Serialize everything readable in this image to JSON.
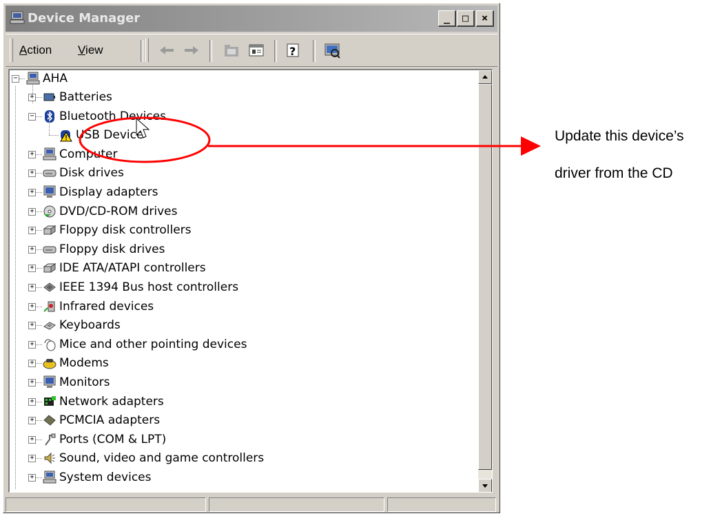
{
  "window": {
    "title": "Device Manager",
    "caption_buttons": {
      "minimize": "_",
      "maximize": "□",
      "close": "×"
    }
  },
  "menu": {
    "action": "Action",
    "view": "View"
  },
  "tree": {
    "root": "AHA",
    "categories": [
      {
        "label": "Batteries",
        "icon": "battery-icon"
      },
      {
        "label": "Bluetooth Devices",
        "icon": "bluetooth-icon",
        "expanded": true,
        "children": [
          {
            "label": "USB Device",
            "icon": "warning-device-icon"
          }
        ]
      },
      {
        "label": "Computer",
        "icon": "computer-icon"
      },
      {
        "label": "Disk drives",
        "icon": "disk-drive-icon"
      },
      {
        "label": "Display adapters",
        "icon": "monitor-icon"
      },
      {
        "label": "DVD/CD-ROM drives",
        "icon": "cd-icon"
      },
      {
        "label": "Floppy disk controllers",
        "icon": "controller-icon"
      },
      {
        "label": "Floppy disk drives",
        "icon": "disk-drive-icon"
      },
      {
        "label": "IDE ATA/ATAPI controllers",
        "icon": "controller-icon"
      },
      {
        "label": "IEEE 1394 Bus host controllers",
        "icon": "firewire-icon"
      },
      {
        "label": "Infrared devices",
        "icon": "infrared-icon"
      },
      {
        "label": "Keyboards",
        "icon": "keyboard-icon"
      },
      {
        "label": "Mice and other pointing devices",
        "icon": "mouse-icon"
      },
      {
        "label": "Modems",
        "icon": "modem-icon"
      },
      {
        "label": "Monitors",
        "icon": "monitor-icon"
      },
      {
        "label": "Network adapters",
        "icon": "network-icon"
      },
      {
        "label": "PCMCIA adapters",
        "icon": "pcmcia-icon"
      },
      {
        "label": "Ports (COM & LPT)",
        "icon": "port-icon"
      },
      {
        "label": "Sound, video and game controllers",
        "icon": "speaker-icon"
      },
      {
        "label": "System devices",
        "icon": "computer-icon"
      }
    ]
  },
  "annotation": {
    "line1": "Update this device’s",
    "line2": "driver from the CD",
    "color": "#ff0000"
  }
}
